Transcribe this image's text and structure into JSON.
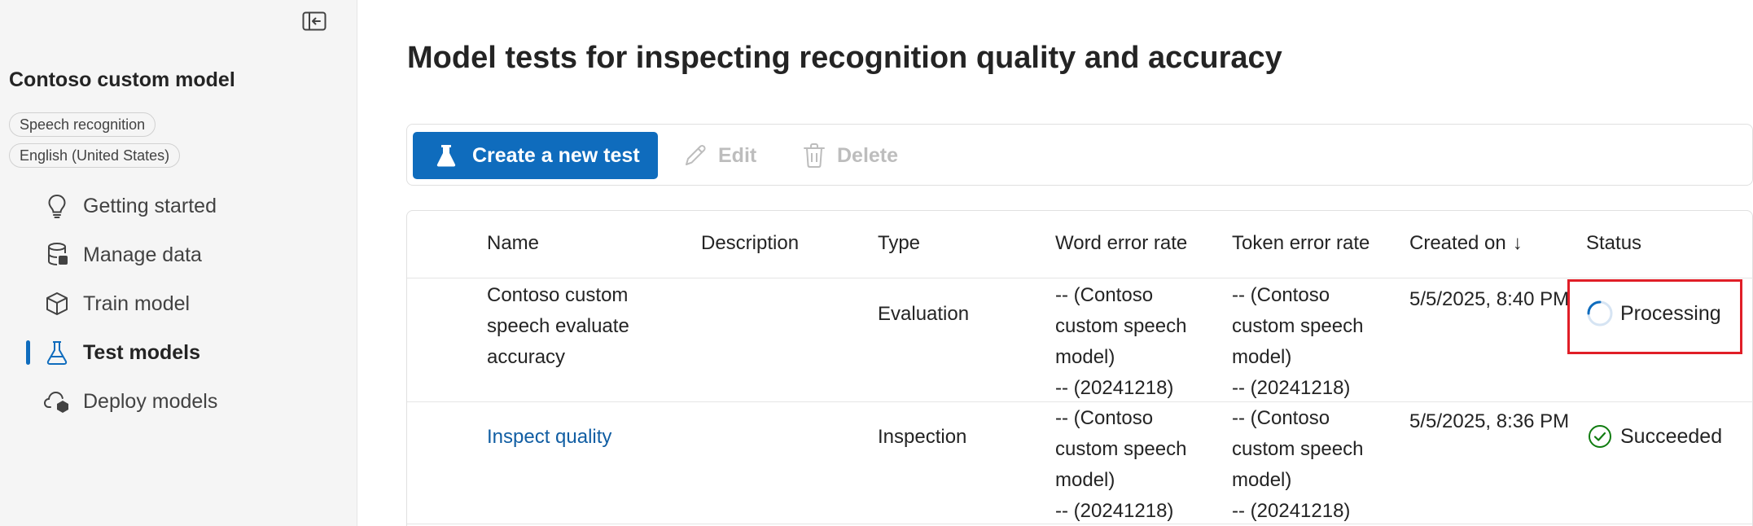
{
  "sidebar": {
    "project_title": "Contoso custom model",
    "chips": [
      "Speech recognition",
      "English (United States)"
    ],
    "items": [
      {
        "label": "Getting started",
        "icon": "lightbulb-icon"
      },
      {
        "label": "Manage data",
        "icon": "database-icon"
      },
      {
        "label": "Train model",
        "icon": "cube-icon"
      },
      {
        "label": "Test models",
        "icon": "beaker-icon",
        "active": true
      },
      {
        "label": "Deploy models",
        "icon": "cloud-deploy-icon"
      }
    ]
  },
  "page": {
    "title": "Model tests for inspecting recognition quality and accuracy"
  },
  "toolbar": {
    "create_label": "Create a new test",
    "edit_label": "Edit",
    "delete_label": "Delete"
  },
  "table": {
    "columns": {
      "name": "Name",
      "description": "Description",
      "type": "Type",
      "wer": "Word error rate",
      "ter": "Token error rate",
      "created": "Created on",
      "status": "Status"
    },
    "sort_indicator": "↓",
    "rows": [
      {
        "name": "Contoso custom speech evaluate accuracy",
        "description": "",
        "type": "Evaluation",
        "wer": "-- (Contoso custom speech model)",
        "wer_2": "-- (20241218)",
        "ter": "-- (Contoso custom speech model)",
        "ter_2": "-- (20241218)",
        "created": "5/5/2025, 8:40 PM",
        "status": "Processing"
      },
      {
        "name": "Inspect quality",
        "description": "",
        "type": "Inspection",
        "wer": "-- (Contoso custom speech model)",
        "wer_2": "-- (20241218)",
        "ter": "-- (Contoso custom speech model)",
        "ter_2": "-- (20241218)",
        "created": "5/5/2025, 8:36 PM",
        "status": "Succeeded"
      }
    ]
  },
  "colors": {
    "accent": "#0f6cbd",
    "link": "#115ea3",
    "success": "#107c10",
    "highlight": "#e01e27"
  }
}
